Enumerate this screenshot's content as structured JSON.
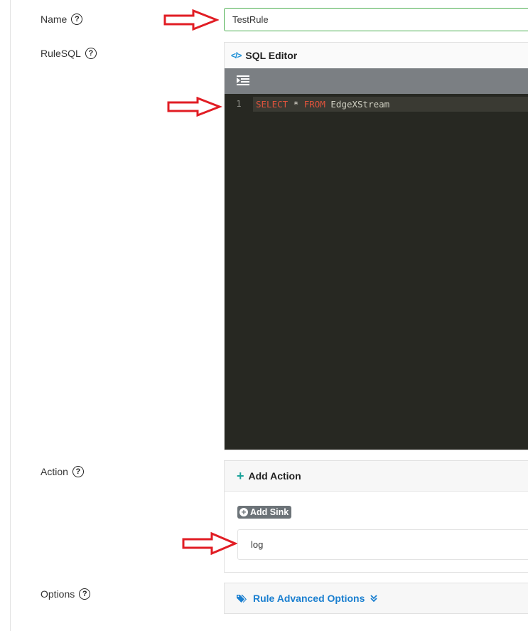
{
  "fields": {
    "name": {
      "label": "Name",
      "help": "?",
      "value": "TestRule"
    },
    "rulesql": {
      "label": "RuleSQL",
      "help": "?"
    },
    "action": {
      "label": "Action",
      "help": "?"
    },
    "options": {
      "label": "Options",
      "help": "?"
    }
  },
  "sql_editor": {
    "title": "SQL Editor",
    "title_icon": "</>",
    "toolbar_icon": "indent-icon",
    "lines": [
      {
        "number": "1",
        "tokens": {
          "kw1": "SELECT",
          "op": "*",
          "kw2": "FROM",
          "ident": "EdgeXStream"
        }
      }
    ]
  },
  "action_panel": {
    "add_action_label": "Add Action",
    "add_sink_label": "Add Sink",
    "sinks": [
      "log"
    ]
  },
  "options_panel": {
    "label": "Rule Advanced Options"
  },
  "colors": {
    "arrow": "#e11d24",
    "accent_blue": "#1a7fd0",
    "add_green": "#1ba39a",
    "input_border_valid": "#4caf50",
    "editor_bg": "#272822",
    "keyword": "#e0533c"
  }
}
